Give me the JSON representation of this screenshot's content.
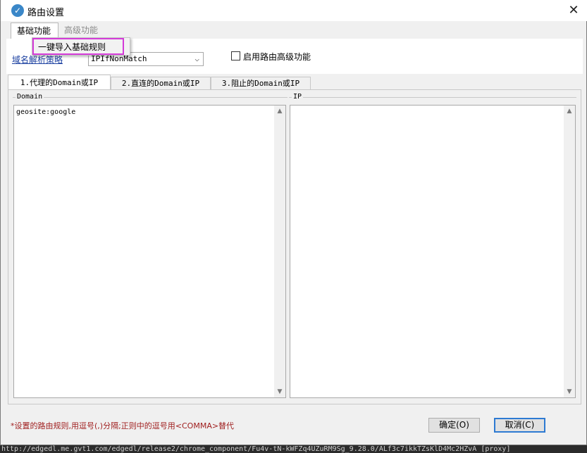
{
  "window": {
    "title": "路由设置",
    "close_symbol": "✕",
    "app_icon": "v-logo-icon"
  },
  "top_tabs": [
    {
      "label": "基础功能",
      "active": true
    },
    {
      "label": "高级功能",
      "active": false
    }
  ],
  "menu": {
    "items": [
      {
        "label": "一键导入基础规则"
      }
    ]
  },
  "strategy": {
    "link_label": "域名解析策略",
    "selected": "IPIfNonMatch"
  },
  "advanced_checkbox": {
    "label": "启用路由高级功能",
    "checked": false
  },
  "inner_tabs": [
    {
      "label": "1.代理的Domain或IP",
      "active": true
    },
    {
      "label": "2.直连的Domain或IP",
      "active": false
    },
    {
      "label": "3.阻止的Domain或IP",
      "active": false
    }
  ],
  "domain_group": {
    "label": "Domain",
    "value": "geosite:google"
  },
  "ip_group": {
    "label": "IP",
    "value": ""
  },
  "hint": "*设置的路由规则,用逗号(,)分隔;正则中的逗号用<COMMA>替代",
  "buttons": {
    "ok": "确定(O)",
    "cancel": "取消(C)"
  },
  "background": {
    "status_line": "http://edgedl.me.gvt1.com/edgedl/release2/chrome_component/Fu4v-tN-kWFZq4UZuRM9Sg_9.28.0/ALf3c7ikkTZsKlD4Mc2HZvA [proxy]"
  },
  "colors": {
    "accent": "#2d7ad2",
    "menu_highlight": "#d43bd8",
    "hint": "#a02020",
    "link": "#1a3fa0"
  }
}
